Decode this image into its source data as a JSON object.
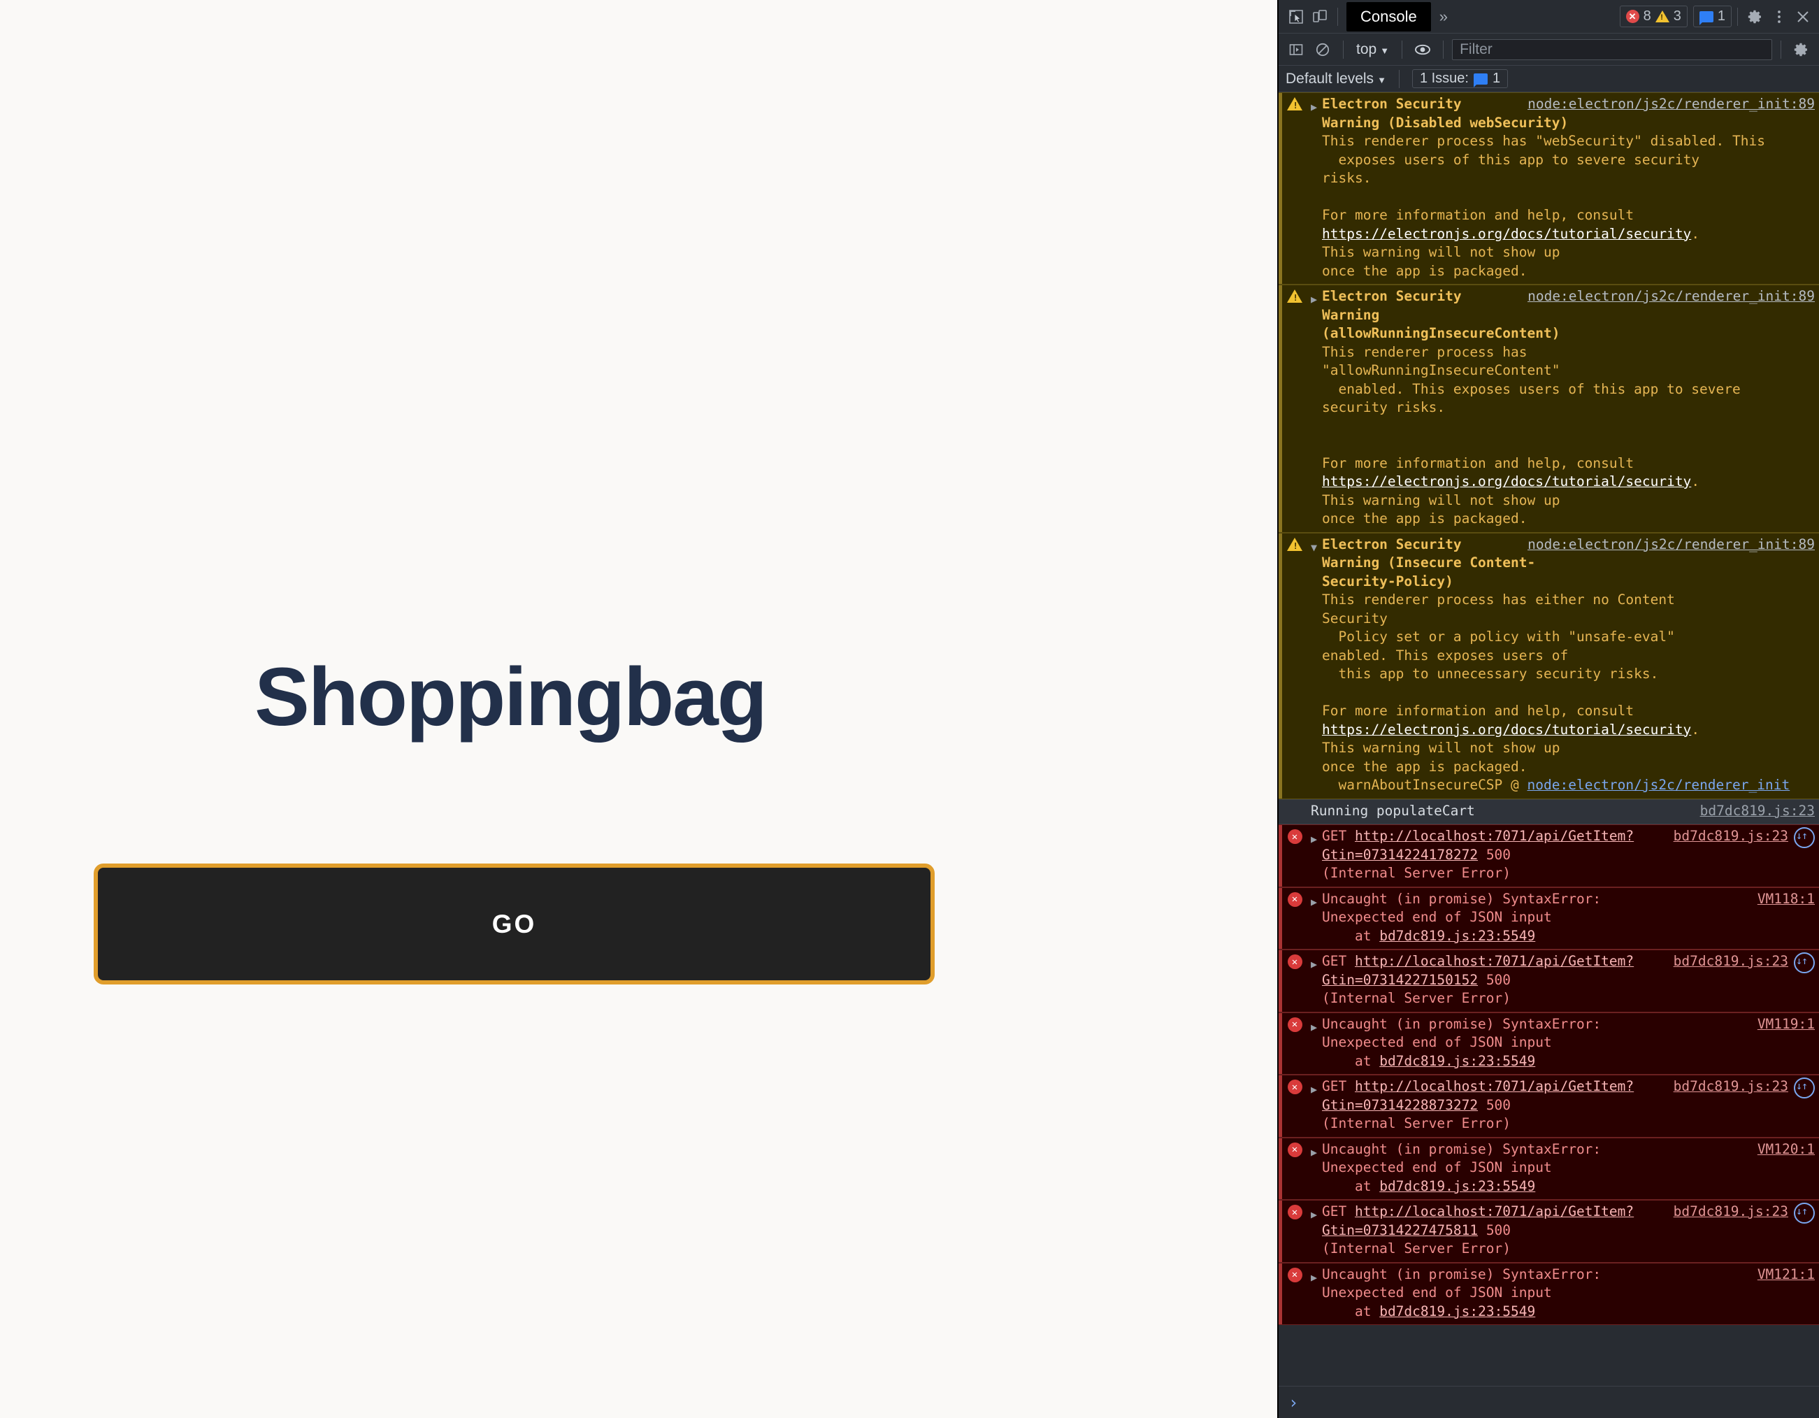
{
  "app": {
    "title": "Shoppingbag",
    "go_button_label": "GO",
    "title_color": "#22304A",
    "button_border_color": "#E09E2C",
    "button_bg_color": "#222222",
    "pane_bg_color": "#FAF9F7"
  },
  "devtools": {
    "tabstrip": {
      "inspect_icon": "inspect-element-icon",
      "device_icon": "device-toolbar-icon",
      "active_tab": "Console",
      "more_tabs": "»",
      "error_count": "8",
      "warning_count": "3",
      "issue_count": "1",
      "settings_icon": "gear-icon",
      "more_icon": "kebab-menu-icon",
      "close_icon": "close-icon"
    },
    "toolbar": {
      "sidebar_icon": "console-sidebar-icon",
      "clear_icon": "clear-console-icon",
      "context": "top",
      "eye_icon": "live-expression-icon",
      "filter_placeholder": "Filter",
      "filter_value": "",
      "settings_icon": "gear-icon"
    },
    "levels": {
      "levels_label": "Default levels",
      "issues_label": "1 Issue:",
      "issues_count": "1"
    },
    "messages": [
      {
        "kind": "warning",
        "expanded": false,
        "source": "node:electron/js2c/renderer_init:89",
        "title": "Electron Security Warning (Disabled webSecurity)",
        "lines": [
          "This renderer process has \"webSecurity\" disabled. This",
          "  exposes users of this app to severe security",
          "risks.",
          "",
          "For more information and help, consult"
        ],
        "link": "https://electronjs.org/docs/tutorial/security",
        "link_suffix": ".",
        "tail": [
          "This warning will not show up",
          "once the app is packaged."
        ],
        "stack": null
      },
      {
        "kind": "warning",
        "expanded": false,
        "source": "node:electron/js2c/renderer_init:89",
        "title": "Electron Security Warning\n(allowRunningInsecureContent)",
        "lines": [
          "This renderer process has",
          "\"allowRunningInsecureContent\"",
          "  enabled. This exposes users of this app to severe",
          "security risks.",
          "",
          "",
          "For more information and help, consult"
        ],
        "link": "https://electronjs.org/docs/tutorial/security",
        "link_suffix": ".",
        "tail": [
          "This warning will not show up",
          "once the app is packaged."
        ],
        "stack": null
      },
      {
        "kind": "warning",
        "expanded": true,
        "source": "node:electron/js2c/renderer_init:89",
        "title": "Electron Security Warning (Insecure Content-\nSecurity-Policy)",
        "lines": [
          "This renderer process has either no Content",
          "Security",
          "  Policy set or a policy with \"unsafe-eval\"",
          "enabled. This exposes users of",
          "  this app to unnecessary security risks.",
          "",
          "For more information and help, consult"
        ],
        "link": "https://electronjs.org/docs/tutorial/security",
        "link_suffix": ".",
        "tail": [
          "This warning will not show up",
          "once the app is packaged."
        ],
        "stack": {
          "fn": "warnAboutInsecureCSP",
          "at": "@",
          "link": "node:electron/js2c/renderer_init"
        }
      },
      {
        "kind": "info",
        "text": "Running populateCart",
        "source": "bd7dc819.js:23"
      },
      {
        "kind": "network-error",
        "method": "GET",
        "url": "http://localhost:7071/api/GetItem?Gtin=07314224178272",
        "status": "500",
        "status_text": "(Internal Server Error)",
        "source": "bd7dc819.js:23",
        "net_icon": "network-request-icon"
      },
      {
        "kind": "error",
        "title": "Uncaught (in promise) SyntaxError:",
        "detail": "Unexpected end of JSON input",
        "at_label": "at",
        "at_link": "bd7dc819.js:23:5549",
        "source": "VM118:1"
      },
      {
        "kind": "network-error",
        "method": "GET",
        "url": "http://localhost:7071/api/GetItem?Gtin=07314227150152",
        "status": "500",
        "status_text": "(Internal Server Error)",
        "source": "bd7dc819.js:23",
        "net_icon": "network-request-icon"
      },
      {
        "kind": "error",
        "title": "Uncaught (in promise) SyntaxError:",
        "detail": "Unexpected end of JSON input",
        "at_label": "at",
        "at_link": "bd7dc819.js:23:5549",
        "source": "VM119:1"
      },
      {
        "kind": "network-error",
        "method": "GET",
        "url": "http://localhost:7071/api/GetItem?Gtin=07314228873272",
        "status": "500",
        "status_text": "(Internal Server Error)",
        "source": "bd7dc819.js:23",
        "net_icon": "network-request-icon"
      },
      {
        "kind": "error",
        "title": "Uncaught (in promise) SyntaxError:",
        "detail": "Unexpected end of JSON input",
        "at_label": "at",
        "at_link": "bd7dc819.js:23:5549",
        "source": "VM120:1"
      },
      {
        "kind": "network-error",
        "method": "GET",
        "url": "http://localhost:7071/api/GetItem?Gtin=07314227475811",
        "status": "500",
        "status_text": "(Internal Server Error)",
        "source": "bd7dc819.js:23",
        "net_icon": "network-request-icon"
      },
      {
        "kind": "error",
        "title": "Uncaught (in promise) SyntaxError:",
        "detail": "Unexpected end of JSON input",
        "at_label": "at",
        "at_link": "bd7dc819.js:23:5549",
        "source": "VM121:1"
      }
    ],
    "prompt_caret": "›"
  }
}
